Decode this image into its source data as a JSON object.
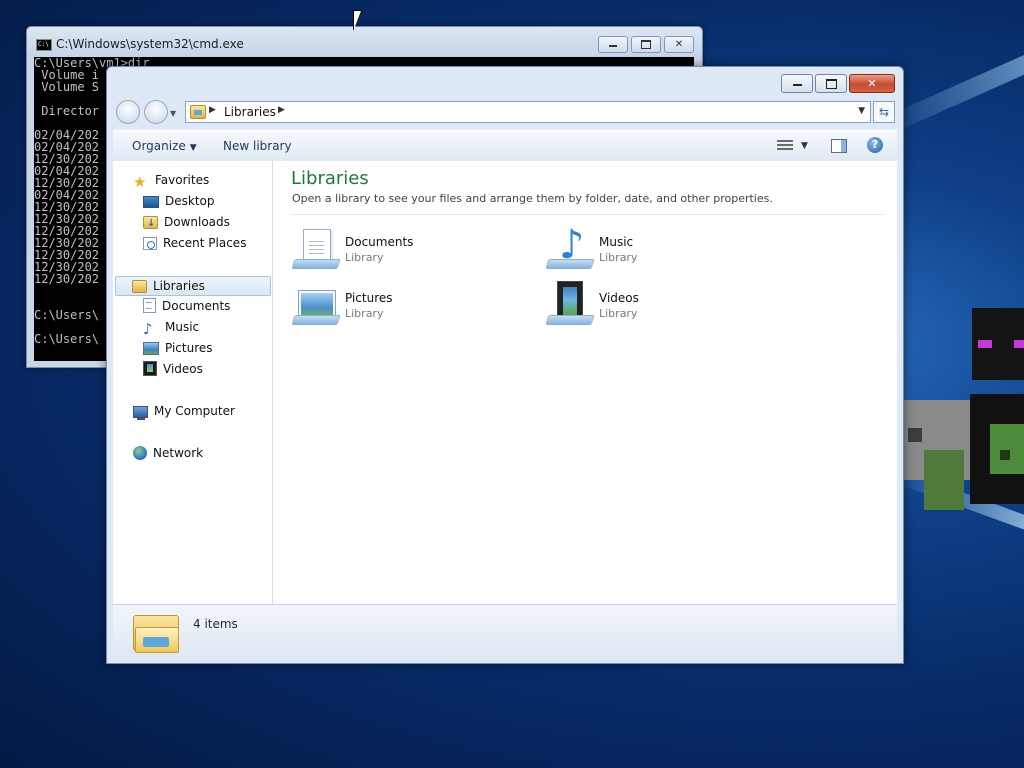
{
  "cmd": {
    "title": "C:\\Windows\\system32\\cmd.exe",
    "icon_text": "C:\\",
    "lines": [
      "C:\\Users\\vm1>dir",
      " Volume i",
      " Volume S",
      "",
      " Director",
      "",
      "02/04/202",
      "02/04/202",
      "12/30/202",
      "02/04/202",
      "12/30/202",
      "02/04/202",
      "12/30/202",
      "12/30/202",
      "12/30/202",
      "12/30/202",
      "12/30/202",
      "12/30/202",
      "12/30/202",
      "",
      "",
      "C:\\Users\\",
      "",
      "C:\\Users\\"
    ]
  },
  "explorer": {
    "address": {
      "path": "Libraries"
    },
    "toolbar": {
      "organize": "Organize",
      "new_library": "New library",
      "help": "?"
    },
    "nav": {
      "favorites": "Favorites",
      "desktop": "Desktop",
      "downloads": "Downloads",
      "recent_places": "Recent Places",
      "libraries": "Libraries",
      "documents": "Documents",
      "music": "Music",
      "pictures": "Pictures",
      "videos": "Videos",
      "my_computer": "My Computer",
      "network": "Network"
    },
    "content": {
      "title": "Libraries",
      "subtitle": "Open a library to see your files and arrange them by folder, date, and other properties.",
      "tiles": [
        {
          "name": "Documents",
          "type": "Library",
          "icon": "documents-library-icon"
        },
        {
          "name": "Music",
          "type": "Library",
          "icon": "music-library-icon"
        },
        {
          "name": "Pictures",
          "type": "Library",
          "icon": "pictures-library-icon"
        },
        {
          "name": "Videos",
          "type": "Library",
          "icon": "videos-library-icon"
        }
      ]
    },
    "status": {
      "item_count": "4 items"
    }
  }
}
